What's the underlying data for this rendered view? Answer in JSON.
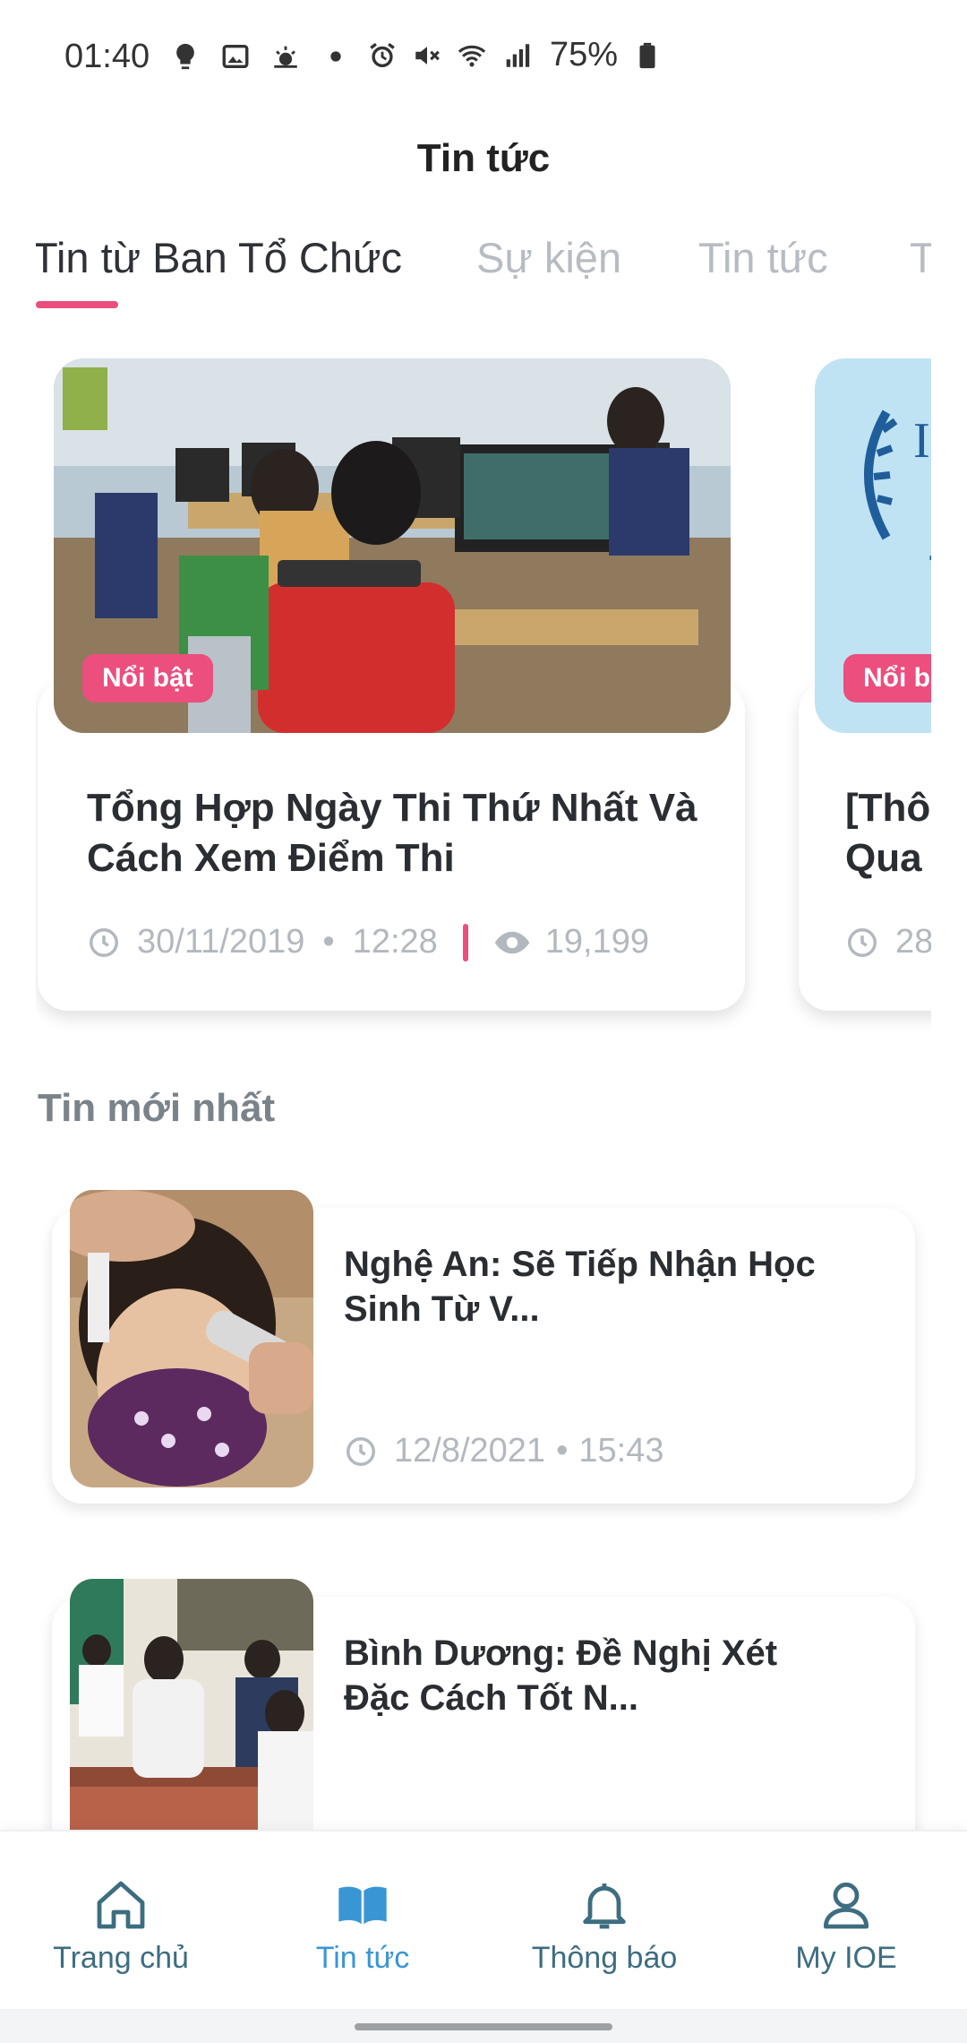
{
  "status_bar": {
    "time": "01:40",
    "battery": "75%",
    "left_icons": [
      "bulb-icon",
      "image-icon",
      "weather-icon",
      "dot-icon"
    ],
    "right_icons": [
      "alarm-icon",
      "mute-icon",
      "wifi-icon",
      "signal-icon",
      "battery-icon"
    ]
  },
  "header": {
    "title": "Tin tức"
  },
  "tabs": [
    {
      "label": "Tin từ Ban Tổ Chức",
      "active": true
    },
    {
      "label": "Sự kiện",
      "active": false
    },
    {
      "label": "Tin tức",
      "active": false
    },
    {
      "label": "T",
      "active": false
    }
  ],
  "featured": [
    {
      "badge": "Nổi bật",
      "title": "Tổng Hợp Ngày Thi Thứ Nhất Và Cách Xem Điểm Thi",
      "date": "30/11/2019",
      "time": "12:28",
      "views": "19,199",
      "image": "computer-lab-photo"
    },
    {
      "badge": "Nổi bật",
      "title": "[Thô Qua",
      "date": "28",
      "image": "ioe-poster"
    }
  ],
  "latest": {
    "heading": "Tin mới nhất",
    "items": [
      {
        "title": "Nghệ An: Sẽ Tiếp Nhận Học Sinh Từ V...",
        "date": "12/8/2021",
        "time": "15:43",
        "image": "temperature-check-photo"
      },
      {
        "title": "Bình Dương: Đề Nghị Xét Đặc Cách Tốt N...",
        "image": "exam-room-photo"
      }
    ]
  },
  "bottom_nav": [
    {
      "label": "Trang chủ",
      "icon": "home-icon",
      "active": false
    },
    {
      "label": "Tin tức",
      "icon": "book-icon",
      "active": true
    },
    {
      "label": "Thông báo",
      "icon": "bell-icon",
      "active": false
    },
    {
      "label": "My IOE",
      "icon": "user-icon",
      "active": false
    }
  ],
  "colors": {
    "accent": "#ec4e7e",
    "nav_active": "#3a95d4",
    "nav_inactive": "#3d6d80",
    "muted_text": "#b3b8be"
  }
}
